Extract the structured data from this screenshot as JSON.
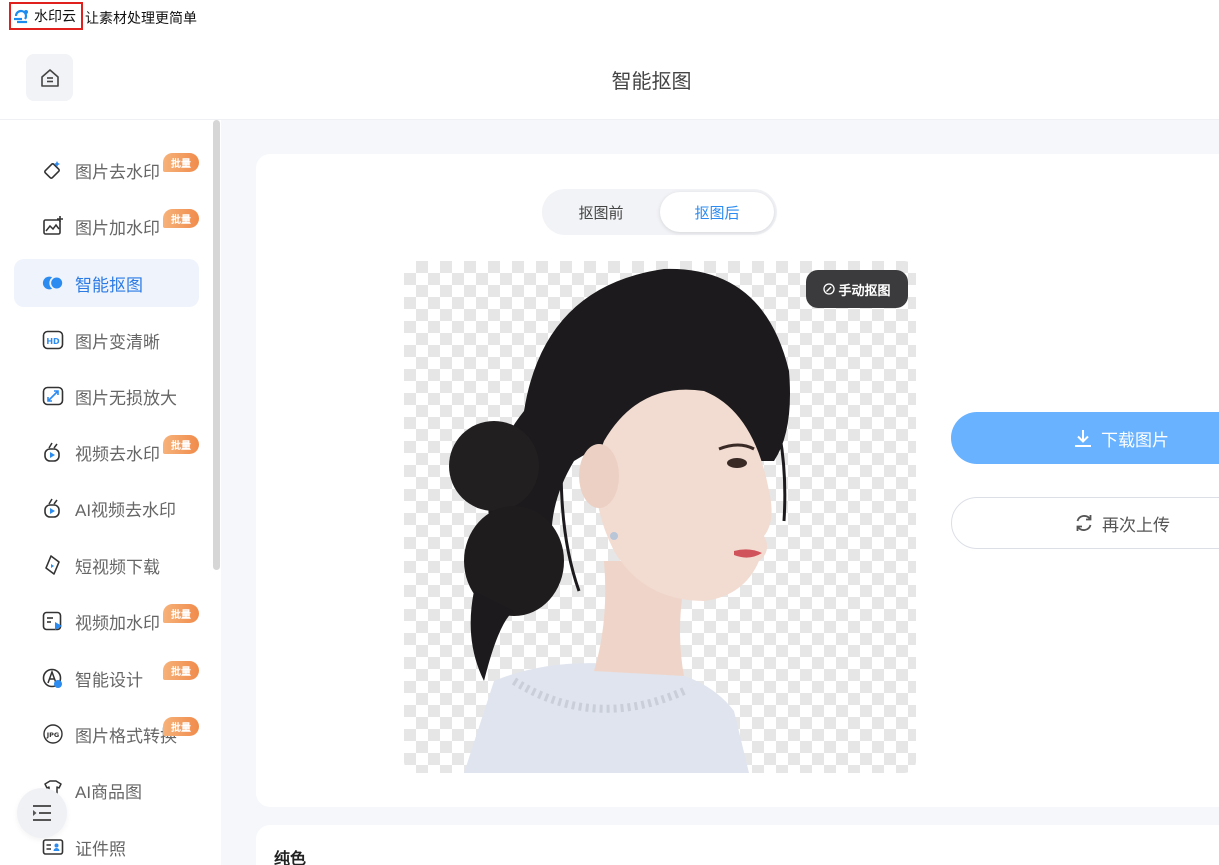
{
  "appbar": {
    "brand_name": "水印云",
    "slogan": "让素材处理更简单"
  },
  "header": {
    "title": "智能抠图"
  },
  "sidebar": {
    "items": [
      {
        "label": "图片去水印",
        "icon": "eraser-icon",
        "badge": "批量"
      },
      {
        "label": "图片加水印",
        "icon": "image-add-icon",
        "badge": "批量"
      },
      {
        "label": "智能抠图",
        "icon": "cutout-icon",
        "active": true
      },
      {
        "label": "图片变清晰",
        "icon": "hd-icon"
      },
      {
        "label": "图片无损放大",
        "icon": "enlarge-icon"
      },
      {
        "label": "视频去水印",
        "icon": "video-eraser-icon",
        "badge": "批量"
      },
      {
        "label": "AI视频去水印",
        "icon": "ai-video-eraser-icon"
      },
      {
        "label": "短视频下载",
        "icon": "short-video-download-icon"
      },
      {
        "label": "视频加水印",
        "icon": "video-add-icon",
        "badge": "批量"
      },
      {
        "label": "智能设计",
        "icon": "design-icon",
        "badge": "批量"
      },
      {
        "label": "图片格式转换",
        "icon": "jpg-convert-icon",
        "badge": "批量"
      },
      {
        "label": "AI商品图",
        "icon": "product-icon"
      },
      {
        "label": "证件照",
        "icon": "id-photo-icon"
      }
    ]
  },
  "main": {
    "tabs": {
      "before": "抠图前",
      "after": "抠图后",
      "selected": "after"
    },
    "manual_button": "手动抠图",
    "download_button": "下载图片",
    "reupload_button": "再次上传",
    "color_section_title": "纯色"
  },
  "colors": {
    "accent": "#2c8bf0",
    "download_bg": "#69b2ff",
    "badge": "#f08b4b",
    "brand_outline": "#e0201c"
  }
}
